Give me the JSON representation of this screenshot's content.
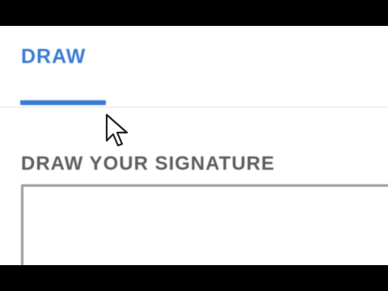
{
  "tabs": [
    {
      "label": "DRAW",
      "active": true
    }
  ],
  "signature": {
    "heading": "DRAW YOUR SIGNATURE"
  },
  "colors": {
    "accent": "#3a7bd5",
    "heading_text": "#5e5e5e",
    "pad_border": "#9c9c9c",
    "letterbox": "#000000"
  },
  "icons": {
    "pointer": "mouse-pointer-icon"
  }
}
